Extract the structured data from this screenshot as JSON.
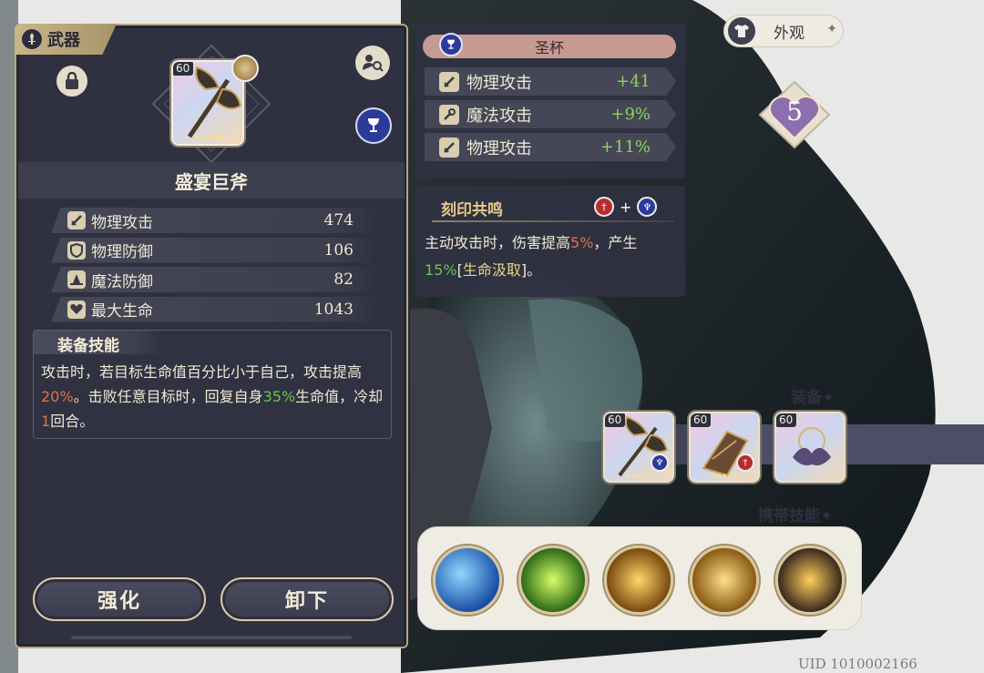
{
  "weapon_panel": {
    "tab_label": "武器",
    "item": {
      "level": "60",
      "stars": "★★★★★",
      "name": "盛宴巨斧"
    },
    "stats": [
      {
        "icon": "sword-icon",
        "name": "物理攻击",
        "value": "474"
      },
      {
        "icon": "shield-icon",
        "name": "物理防御",
        "value": "106"
      },
      {
        "icon": "wizard-hat-icon",
        "name": "魔法防御",
        "value": "82"
      },
      {
        "icon": "heart-icon",
        "name": "最大生命",
        "value": "1043"
      }
    ],
    "skill": {
      "title": "装备技能",
      "seg1": "攻击时，若目标生命值百分比小于自己，攻击提高",
      "pct1": "20%",
      "seg2": "。击败任意目标时，回复自身",
      "pct2": "35%",
      "seg3": "生命值，冷却",
      "cooldown": "1",
      "seg4": "回合。"
    },
    "buttons": {
      "enhance": "强化",
      "unequip": "卸下"
    }
  },
  "grail_panel": {
    "header": "圣杯",
    "substats": [
      {
        "icon": "sword-icon",
        "name": "物理攻击",
        "value": "+41"
      },
      {
        "icon": "wand-icon",
        "name": "魔法攻击",
        "value": "+9%"
      },
      {
        "icon": "sword-icon",
        "name": "物理攻击",
        "value": "+11%"
      }
    ]
  },
  "resonance": {
    "title": "刻印共鸣",
    "plus": "+",
    "seg1": "主动攻击时，伤害提高",
    "pct1": "5%",
    "seg2": "，产生",
    "pct2": "15%",
    "bracket_open": "[",
    "effect": "生命汲取",
    "bracket_close": "]。"
  },
  "appearance": {
    "label": "外观",
    "star": "✦"
  },
  "character_level": "5",
  "equipment": {
    "label": "装备✦",
    "slots": [
      {
        "level": "60",
        "stars": "★★★★★",
        "rune": "blue"
      },
      {
        "level": "60",
        "stars": "★★★★★",
        "rune": "red"
      },
      {
        "level": "60",
        "stars": "",
        "rune": ""
      }
    ]
  },
  "carry_skills": {
    "label": "携带技能✦"
  },
  "uid": "UID 1010002166",
  "colors": {
    "panel_bg": "#2f3140",
    "gold_border": "#b8a57c",
    "highlight_orange": "#e27248",
    "highlight_green": "#6ac253",
    "substat_green": "#8fd25a",
    "grail_blue": "#2c3b9a",
    "rune_red": "#b72d2d"
  }
}
